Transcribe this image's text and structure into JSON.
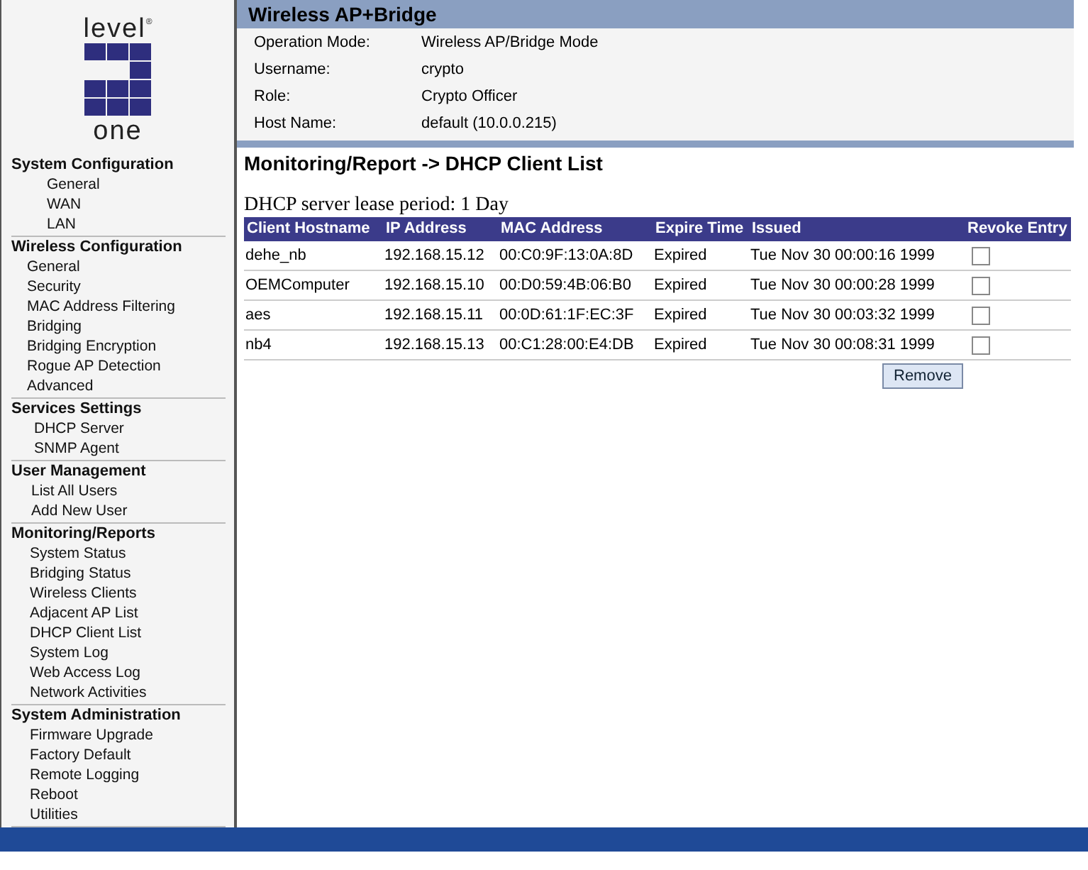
{
  "logo": {
    "top": "level",
    "mark": "®",
    "bottom": "one"
  },
  "sidebar": {
    "sections": [
      {
        "title": "System Configuration",
        "items": [
          "General",
          "WAN",
          "LAN"
        ]
      },
      {
        "title": "Wireless Configuration",
        "items": [
          "General",
          "Security",
          "MAC Address Filtering",
          "Bridging",
          "Bridging Encryption",
          "Rogue AP Detection",
          "Advanced"
        ]
      },
      {
        "title": "Services Settings",
        "items": [
          "DHCP Server",
          "SNMP Agent"
        ]
      },
      {
        "title": "User Management",
        "items": [
          "List All Users",
          "Add New User"
        ]
      },
      {
        "title": "Monitoring/Reports",
        "items": [
          "System Status",
          "Bridging Status",
          "Wireless Clients",
          "Adjacent AP List",
          "DHCP Client List",
          "System Log",
          "Web Access Log",
          "Network Activities"
        ]
      },
      {
        "title": "System Administration",
        "items": [
          "Firmware Upgrade",
          "Factory Default",
          "Remote Logging",
          "Reboot",
          "Utilities"
        ]
      }
    ]
  },
  "header": {
    "title": "Wireless AP+Bridge",
    "info": [
      {
        "label": "Operation Mode:",
        "value": "Wireless AP/Bridge Mode"
      },
      {
        "label": "Username:",
        "value": "crypto"
      },
      {
        "label": "Role:",
        "value": "Crypto Officer"
      },
      {
        "label": "Host Name:",
        "value": "default (10.0.0.215)"
      }
    ]
  },
  "page_title": "Monitoring/Report -> DHCP Client List",
  "lease_text": "DHCP server lease period: 1 Day",
  "table": {
    "columns": [
      "Client Hostname",
      "IP Address",
      "MAC Address",
      "Expire Time",
      "Issued",
      "Revoke Entry"
    ],
    "rows": [
      {
        "cells": [
          "dehe_nb",
          "192.168.15.12",
          "00:C0:9F:13:0A:8D",
          "Expired",
          "Tue Nov 30 00:00:16 1999"
        ],
        "checked": false
      },
      {
        "cells": [
          "OEMComputer",
          "192.168.15.10",
          "00:D0:59:4B:06:B0",
          "Expired",
          "Tue Nov 30 00:00:28 1999"
        ],
        "checked": false
      },
      {
        "cells": [
          "aes",
          "192.168.15.11",
          "00:0D:61:1F:EC:3F",
          "Expired",
          "Tue Nov 30 00:03:32 1999"
        ],
        "checked": false
      },
      {
        "cells": [
          "nb4",
          "192.168.15.13",
          "00:C1:28:00:E4:DB",
          "Expired",
          "Tue Nov 30 00:08:31 1999"
        ],
        "checked": false
      }
    ]
  },
  "remove_button": "Remove"
}
